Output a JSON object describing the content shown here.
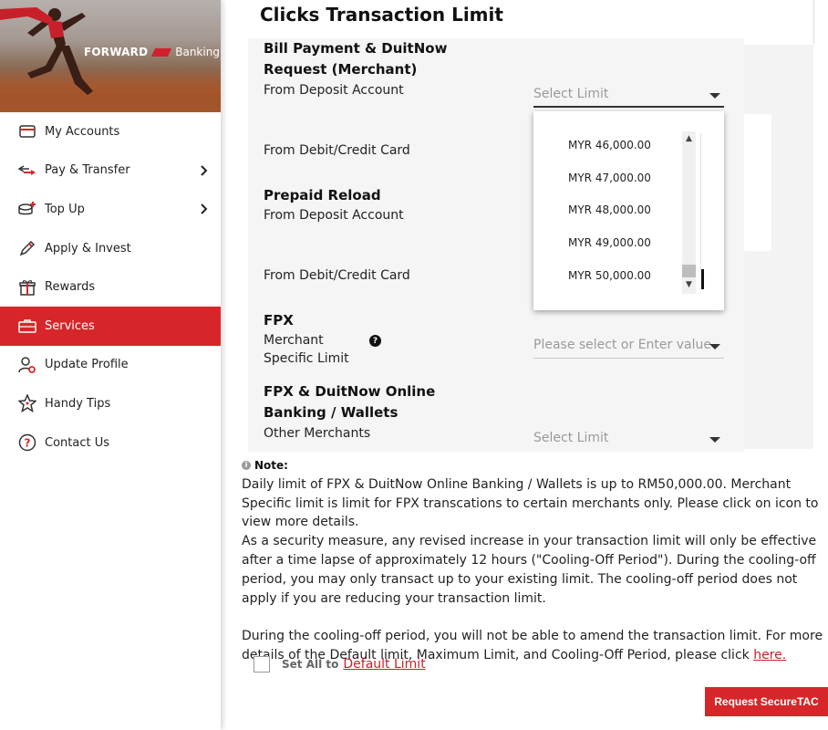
{
  "brand": {
    "name": "FORWARD",
    "suffix": "Banking"
  },
  "colors": {
    "accent": "#d7262a",
    "link": "#c8202a",
    "panel": "#f5f5f5"
  },
  "sidebar": {
    "items": [
      {
        "label": "My Accounts",
        "icon": "card-icon",
        "chevron": false,
        "active": false
      },
      {
        "label": "Pay & Transfer",
        "icon": "transfer-icon",
        "chevron": true,
        "active": false
      },
      {
        "label": "Top Up",
        "icon": "topup-icon",
        "chevron": true,
        "active": false
      },
      {
        "label": "Apply & Invest",
        "icon": "pen-icon",
        "chevron": false,
        "active": false
      },
      {
        "label": "Rewards",
        "icon": "gift-icon",
        "chevron": false,
        "active": false
      },
      {
        "label": "Services",
        "icon": "briefcase-icon",
        "chevron": false,
        "active": true
      },
      {
        "label": "Update Profile",
        "icon": "profile-gear-icon",
        "chevron": false,
        "active": false
      },
      {
        "label": "Handy Tips",
        "icon": "star-icon",
        "chevron": false,
        "active": false
      },
      {
        "label": "Contact Us",
        "icon": "question-icon",
        "chevron": false,
        "active": false
      }
    ]
  },
  "main": {
    "title": "Clicks Transaction Limit",
    "bill": {
      "title_line1": "Bill Payment & DuitNow",
      "title_line2": "Request (Merchant)",
      "deposit_label": "From Deposit Account",
      "card_label": "From Debit/Credit Card",
      "select_placeholder": "Select Limit"
    },
    "dropdown": {
      "options": [
        "MYR 46,000.00",
        "MYR 47,000.00",
        "MYR 48,000.00",
        "MYR 49,000.00",
        "MYR 50,000.00"
      ]
    },
    "prepaid": {
      "title": "Prepaid Reload",
      "deposit_label": "From Deposit Account",
      "card_label": "From Debit/Credit Card"
    },
    "fpx": {
      "title": "FPX",
      "label_line1": "Merchant",
      "label_line2": "Specific Limit",
      "help": "?",
      "select_placeholder": "Please select or Enter value"
    },
    "fpx_duitnow": {
      "title_line1": "FPX & DuitNow Online",
      "title_line2": "Banking / Wallets",
      "label": "Other Merchants",
      "select_placeholder": "Select Limit"
    },
    "note": {
      "heading": "Note:",
      "para1": "Daily limit of FPX & DuitNow Online Banking / Wallets is up to RM50,000.00. Merchant Specific limit is limit for FPX transcations to certain merchants only. Please click on icon to view more details.",
      "para2": "As a security measure, any revised increase in your transaction limit will only be effective after a time lapse of approximately 12 hours (\"Cooling-Off Period\"). During the cooling-off period, you may only transact up to your existing limit. The cooling-off period does not apply if you are reducing your transaction limit.",
      "para3": "During the cooling-off period, you will not be able to amend the transaction limit. For more details of the Default limit, Maximum Limit, and Cooling-Off Period, please click ",
      "link": "here."
    },
    "set_all": {
      "label": "Set All to",
      "link": "Default Limit",
      "checked": false
    },
    "button": "Request SecureTAC"
  }
}
